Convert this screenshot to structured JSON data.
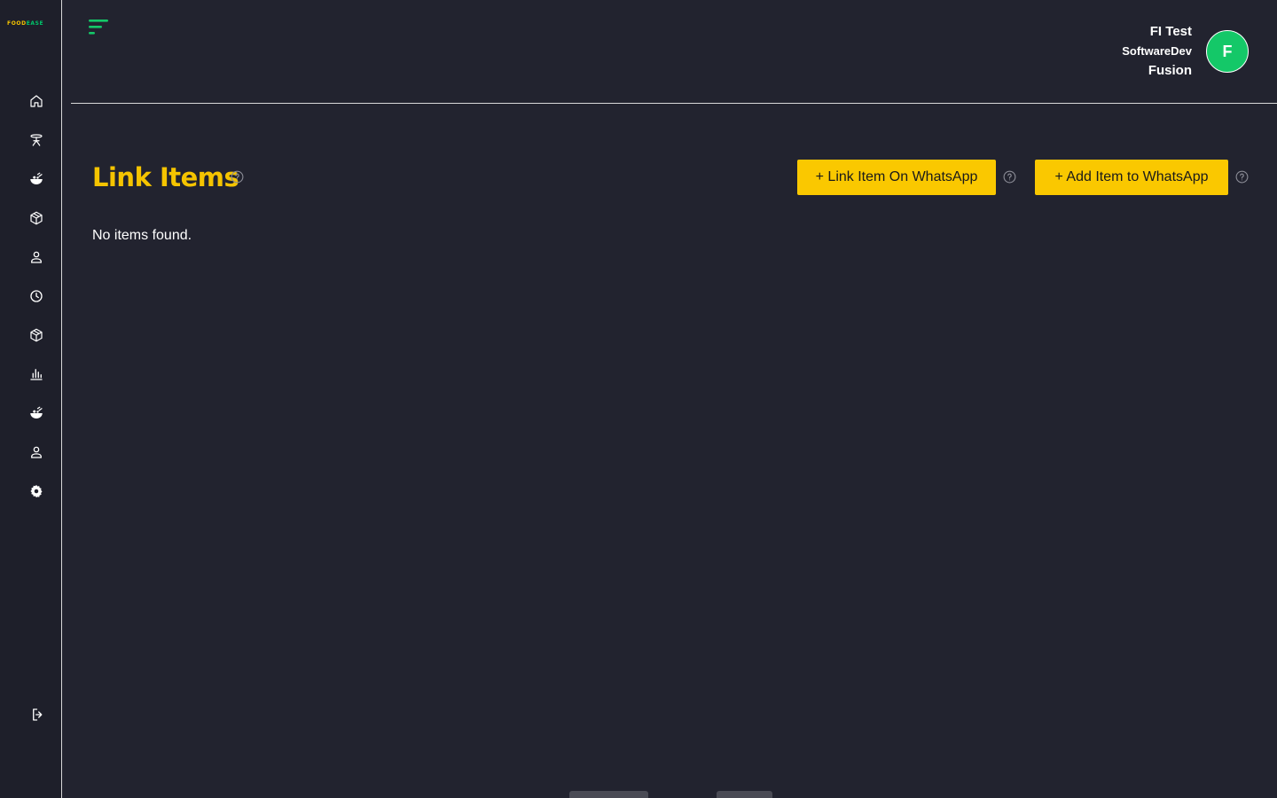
{
  "sidebar": {
    "logo": {
      "part1": "FOOD",
      "part2": "EASE",
      "color1": "#f5c400",
      "color2": "#00c46a"
    },
    "items": [
      {
        "icon": "home-icon"
      },
      {
        "icon": "dining-table-icon"
      },
      {
        "icon": "food-bowl-icon"
      },
      {
        "icon": "box-icon"
      },
      {
        "icon": "user-icon"
      },
      {
        "icon": "clock-icon"
      },
      {
        "icon": "box-icon"
      },
      {
        "icon": "bar-chart-icon"
      },
      {
        "icon": "food-bowl-icon"
      },
      {
        "icon": "user-icon"
      },
      {
        "icon": "gear-icon"
      }
    ],
    "logout_icon": "logout-icon"
  },
  "header": {
    "menu_icon": "menu-icon",
    "user": {
      "line1": "FI Test",
      "line2": "SoftwareDev",
      "line3": "Fusion",
      "avatar_initial": "F",
      "avatar_color": "#14c868"
    }
  },
  "main": {
    "title": "Link Items",
    "buttons": {
      "link_item": "+ Link Item On WhatsApp",
      "add_item": "+ Add Item to WhatsApp"
    },
    "empty_message": "No items found.",
    "accent_color": "#f5c400",
    "button_color": "#fac800"
  }
}
